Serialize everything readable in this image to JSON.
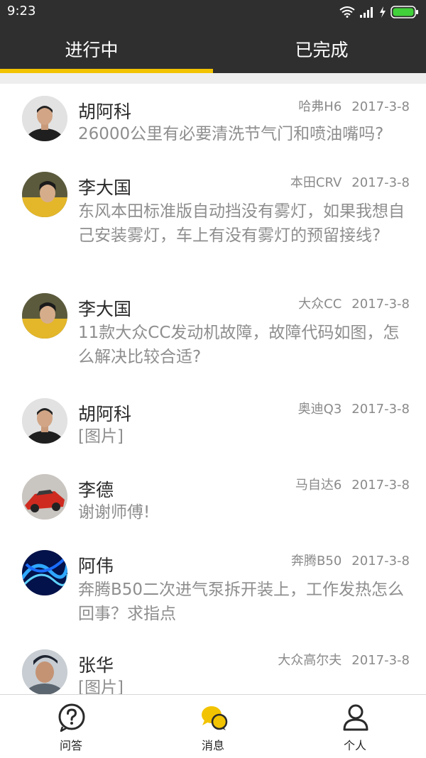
{
  "status": {
    "time": "9:23"
  },
  "tabs": [
    {
      "label": "进行中",
      "active": true
    },
    {
      "label": "已完成",
      "active": false
    }
  ],
  "accent_color": "#f2c300",
  "messages": [
    {
      "name": "胡阿科",
      "car": "哈弗H6",
      "date": "2017-3-8",
      "text": "26000公里有必要清洗节气门和喷油嘴吗?"
    },
    {
      "name": "李大国",
      "car": "本田CRV",
      "date": "2017-3-8",
      "text": "东风本田标准版自动挡没有雾灯，如果我想自己安装雾灯，车上有没有雾灯的预留接线?"
    },
    {
      "name": "李大国",
      "car": "大众CC",
      "date": "2017-3-8",
      "text": "11款大众CC发动机故障，故障代码如图，怎么解决比较合适?"
    },
    {
      "name": "胡阿科",
      "car": "奥迪Q3",
      "date": "2017-3-8",
      "text": "[图片]"
    },
    {
      "name": "李德",
      "car": "马自达6",
      "date": "2017-3-8",
      "text": "谢谢师傅!"
    },
    {
      "name": "阿伟",
      "car": "奔腾B50",
      "date": "2017-3-8",
      "text": "奔腾B50二次进气泵拆开装上，工作发热怎么回事？求指点"
    },
    {
      "name": "张华",
      "car": "大众高尔夫",
      "date": "2017-3-8",
      "text": "[图片]"
    }
  ],
  "bottom_nav": [
    {
      "label": "问答",
      "icon": "question-icon"
    },
    {
      "label": "消息",
      "icon": "chat-bubbles-icon",
      "active": true
    },
    {
      "label": "个人",
      "icon": "person-icon"
    }
  ]
}
